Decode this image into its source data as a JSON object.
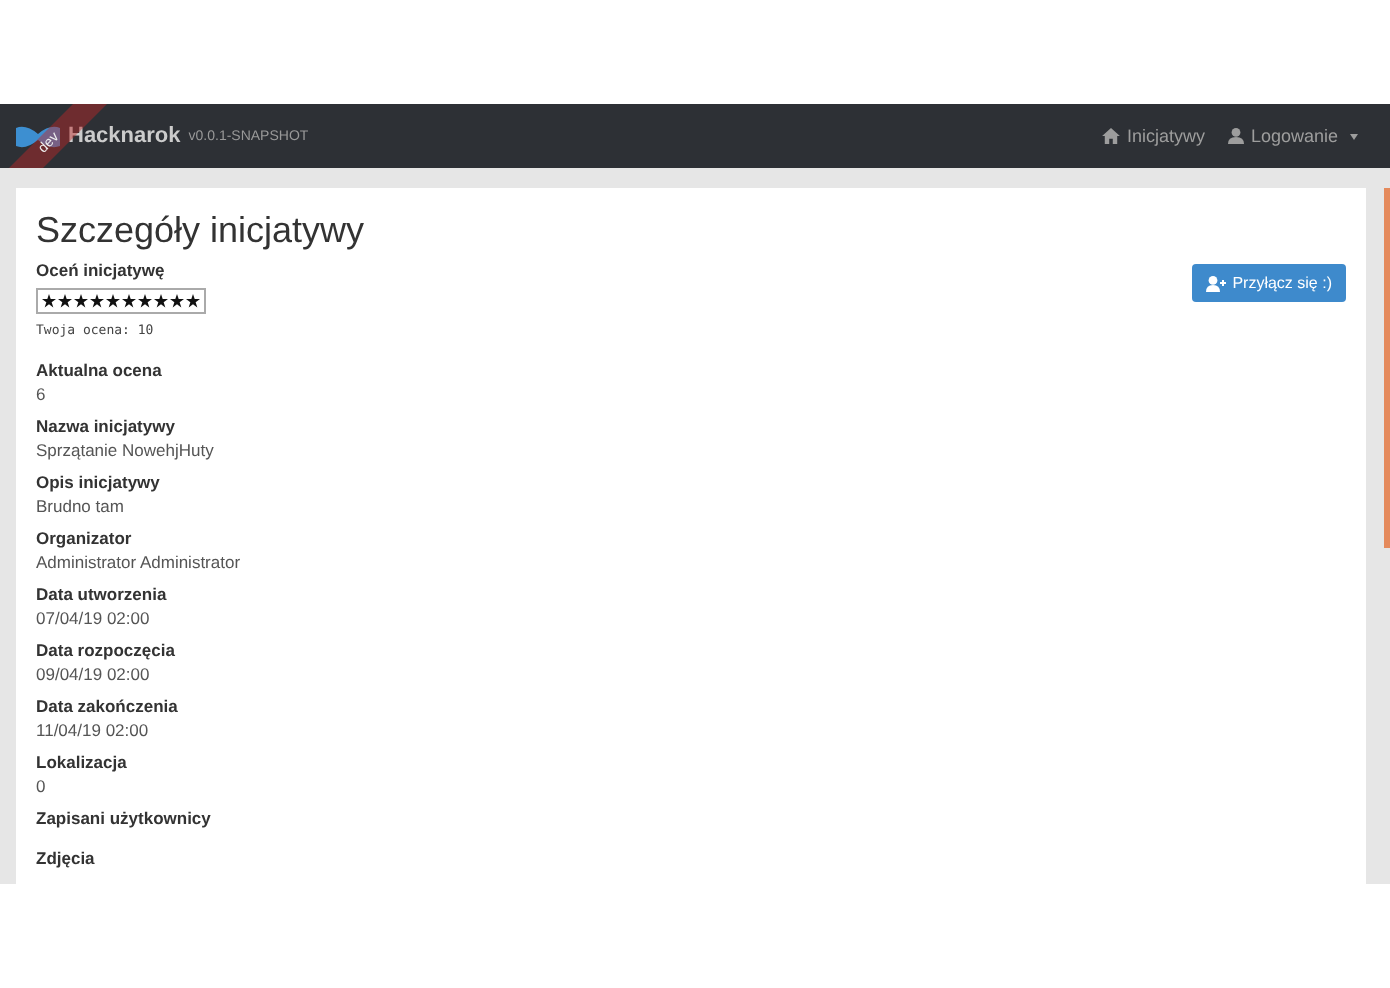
{
  "navbar": {
    "brand": "Hacknarok",
    "version": "v0.0.1-SNAPSHOT",
    "ribbon": "dev",
    "links": [
      {
        "label": "Inicjatywy",
        "kind": "home"
      },
      {
        "label": "Logowanie",
        "kind": "user"
      }
    ]
  },
  "page": {
    "title": "Szczegóły inicjatywy",
    "join_button": "Przyłącz się :)",
    "rating": {
      "label": "Oceń inicjatywę",
      "stars": 10,
      "note": "Twoja ocena: 10"
    },
    "fields": [
      {
        "label": "Aktualna ocena",
        "value": "6"
      },
      {
        "label": "Nazwa inicjatywy",
        "value": "Sprzątanie NowehjHuty"
      },
      {
        "label": "Opis inicjatywy",
        "value": "Brudno tam"
      },
      {
        "label": "Organizator",
        "value": "Administrator Administrator"
      },
      {
        "label": "Data utworzenia",
        "value": "07/04/19 02:00"
      },
      {
        "label": "Data rozpoczęcia",
        "value": "09/04/19 02:00"
      },
      {
        "label": "Data zakończenia",
        "value": "11/04/19 02:00"
      },
      {
        "label": "Lokalizacja",
        "value": "0"
      },
      {
        "label": "Zapisani użytkownicy"
      },
      {
        "label": "Zdjęcia"
      }
    ]
  }
}
